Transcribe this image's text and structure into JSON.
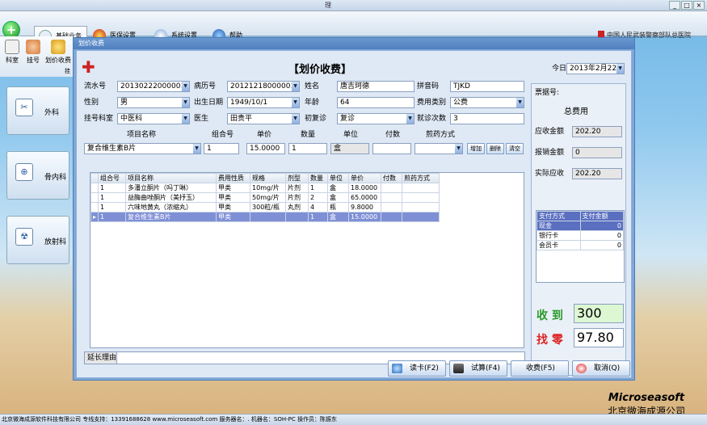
{
  "app": {
    "title_fragment": "理",
    "hospital": "中国人民武装警察部队总医院"
  },
  "menu": {
    "tabs": [
      "基础业务",
      "医保设置",
      "系统设置",
      "帮助"
    ]
  },
  "ribbon": {
    "items": [
      "科室",
      "挂号",
      "划价收费"
    ],
    "group_fragment": "挂"
  },
  "nav": {
    "items": [
      "外科",
      "骨内科",
      "放射科"
    ]
  },
  "dialog": {
    "window_title": "划价收费",
    "heading": "【划价收费】",
    "today_label": "今日",
    "today_value": "2013年2月22日",
    "labels": {
      "serial": "流水号",
      "record": "病历号",
      "name": "姓名",
      "pinyin": "拼音码",
      "gender": "性别",
      "birth": "出生日期",
      "age": "年龄",
      "fee_type": "费用类别",
      "dept": "挂号科室",
      "doctor": "医生",
      "visit": "初复诊",
      "visit_count": "就诊次数"
    },
    "values": {
      "serial": "20130222000001",
      "record": "20121218000001",
      "name": "唐吉珂德",
      "pinyin": "TJKD",
      "gender": "男",
      "birth": "1949/10/1",
      "age": "64",
      "fee_type": "公费",
      "dept": "中医科",
      "doctor": "田贵平",
      "visit": "复诊",
      "visit_count": "3"
    },
    "entry": {
      "labels": [
        "项目名称",
        "组合号",
        "单价",
        "数量",
        "单位",
        "付数",
        "煎药方式"
      ],
      "item": "复合维生素B片",
      "group": "1",
      "price": "15.0000",
      "qty": "1",
      "unit": "盒",
      "paid": "",
      "method": ""
    },
    "entry_buttons": [
      "增加",
      "删除",
      "清空"
    ],
    "table": {
      "headers": [
        "组合号",
        "项目名称",
        "费用性质",
        "规格",
        "剂型",
        "数量",
        "单位",
        "单价",
        "付数",
        "煎药方式"
      ],
      "rows": [
        [
          "1",
          "多潘立酮片（吗丁啉）",
          "甲类",
          "10mg/片",
          "片剂",
          "1",
          "盒",
          "18.0000",
          "",
          ""
        ],
        [
          "1",
          "益酶曲唑酮片（美抒玉）",
          "甲类",
          "50mg/片",
          "片剂",
          "2",
          "盒",
          "65.0000",
          "",
          ""
        ],
        [
          "1",
          "六味地黄丸（浓缩丸）",
          "甲类",
          "300粒/瓶",
          "丸剂",
          "4",
          "瓶",
          "9.8000",
          "",
          ""
        ],
        [
          "1",
          "复合维生素B片",
          "甲类",
          "",
          "",
          "1",
          "盒",
          "15.0000",
          "",
          ""
        ]
      ]
    },
    "reason_label": "延长理由",
    "reason_value": "",
    "summary": {
      "ticket_label": "票据号:",
      "total_title": "总费用",
      "due_label": "应收金额",
      "due": "202.20",
      "reimb_label": "报销金额",
      "reimb": "0",
      "actual_label": "实际应收",
      "actual": "202.20"
    },
    "pay_table": {
      "headers": [
        "支付方式",
        "支付金额"
      ],
      "rows": [
        [
          "现金",
          "0"
        ],
        [
          "银行卡",
          "0"
        ],
        [
          "会员卡",
          "0"
        ]
      ]
    },
    "received_label": "收 到",
    "received": "300",
    "change_label": "找 零",
    "change": "97.80",
    "buttons": [
      "读卡(F2)",
      "试算(F4)",
      "收费(F5)",
      "取消(Q)"
    ]
  },
  "status": {
    "text": "北京微海成源软件科技有限公司    专线支持：13391688628    www.microseasoft.com    服务器名：. 机器名：SOH-PC 操作员：陈振东"
  },
  "brand": {
    "en": "Microseasoft",
    "cn": "北京微海成源公司"
  },
  "colors": {
    "accent": "#4f7fbf",
    "received_bg": "#dcf7d2",
    "selected_row": "#7f8fd6"
  }
}
